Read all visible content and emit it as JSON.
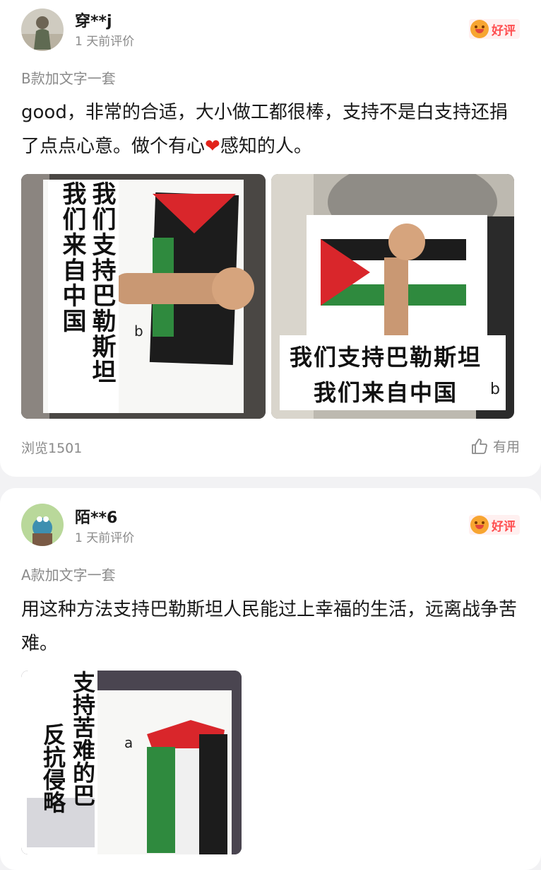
{
  "reviews": [
    {
      "username": "穿**j",
      "time": "1 天前评价",
      "badge": "好评",
      "variant": "B款加文字一套",
      "text_before_heart": "good，非常的合适，大小做工都很棒，支持不是白支持还捐了点点心意。做个有心",
      "heart": "❤",
      "text_after_heart": "感知的人。",
      "photos": [
        {
          "line1": "我们支持巴勒斯坦",
          "line2": "我们来自中国",
          "mark": "b"
        },
        {
          "line1": "我们支持巴勒斯坦",
          "line2": "我们来自中国",
          "mark": "b"
        }
      ],
      "views": "浏览1501",
      "helpful": "有用"
    },
    {
      "username": "陌**6",
      "time": "1 天前评价",
      "badge": "好评",
      "variant": "A款加文字一套",
      "text": "用这种方法支持巴勒斯坦人民能过上幸福的生活，远离战争苦难。",
      "photos": [
        {
          "line1": "支持苦难的巴",
          "line2": "反抗侵略",
          "mark": "a"
        }
      ]
    }
  ],
  "colors": {
    "flag_red": "#d9262b",
    "flag_green": "#2f8a3e",
    "flag_black": "#1c1c1c",
    "badge_text": "#ff4d4f"
  }
}
